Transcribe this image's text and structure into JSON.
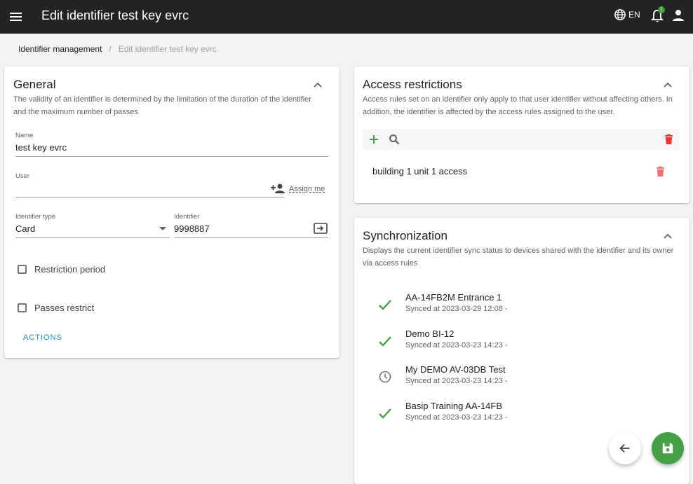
{
  "header": {
    "title": "Edit identifier test key evrc",
    "language": "EN",
    "notification_count": "!"
  },
  "breadcrumb": {
    "parent": "Identifier management",
    "separator": "/",
    "current": "Edit identifier test key evrc"
  },
  "general": {
    "title": "General",
    "description": "The validity of an identifier is determined by the limitation of the duration of the identifier and the maximum number of passes",
    "name_label": "Name",
    "name_value": "test key evrc",
    "user_label": "User",
    "user_value": "",
    "assign_me": "Assign me",
    "type_label": "Identifier type",
    "type_value": "Card",
    "identifier_label": "Identifier",
    "identifier_value": "9998887",
    "restriction_period": "Restriction period",
    "passes_restrict": "Passes restrict",
    "actions": "ACTIONS"
  },
  "access": {
    "title": "Access restrictions",
    "description": "Access rules set on an identifier only apply to that user identifier without affecting others. In addition, the identifier is affected by the access rules assigned to the user.",
    "rules": [
      "building 1 unit 1 access"
    ]
  },
  "sync": {
    "title": "Synchronization",
    "description": "Displays the current identifier sync status to devices shared with the identifier and its owner via access rules",
    "items": [
      {
        "name": "AA-14FB2M Entrance 1",
        "status": "Synced at 2023-03-29 12:08 -",
        "state": "synced"
      },
      {
        "name": "Demo BI-12",
        "status": "Synced at 2023-03-23 14:23 -",
        "state": "synced"
      },
      {
        "name": "My DEMO AV-03DB Test",
        "status": "Synced at 2023-03-23 14:23 -",
        "state": "pending"
      },
      {
        "name": "Basip Training AA-14FB",
        "status": "Synced at 2023-03-23 14:23 -",
        "state": "synced"
      }
    ]
  },
  "colors": {
    "topbar": "#232323",
    "accent_green": "#43a047",
    "danger_red": "#e53935",
    "link_blue": "#1e88c9"
  }
}
